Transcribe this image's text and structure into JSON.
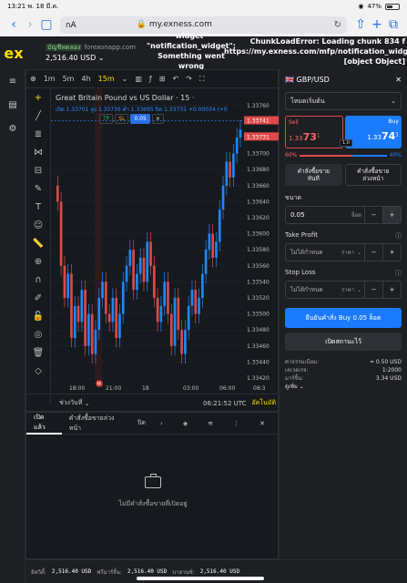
{
  "status": {
    "time": "13:21",
    "date": "พ. 18 มี.ค.",
    "battery": "47%"
  },
  "browser": {
    "aa": "กA",
    "domain": "my.exness.com"
  },
  "app": {
    "logo": "ex",
    "account_tag": "บัญชีทดลอง",
    "account_site": "forexonapp.com",
    "balance": "2,516.40 USD",
    "error1": "widget\"\n\"notification_widget\":\nSomething went\nwrong",
    "error2": "ChunkLoadError: Loading chunk 834 f\nhttps://my.exness.com/mfp/notification_widget\n[object Object]"
  },
  "chart": {
    "toolbar": [
      "1m",
      "5m",
      "4h",
      "15m"
    ],
    "active_tf": "15m",
    "title": "Great Britain Pound vs US Dollar · 15 ·",
    "ohlc": "เปิด 1.33701  สูง 1.33736  ต่ำ 1.33695  ปิด 1.33731  +0.00034 (+0",
    "tp": "TP",
    "sl": "SL",
    "lot": "0.05",
    "time_labels": [
      "18:00",
      "21:00",
      "18",
      "03:00",
      "06:00",
      "08:3"
    ],
    "price_labels": [
      "1.33760",
      "1.33740",
      "1.33720",
      "1.33700",
      "1.33680",
      "1.33660",
      "1.33640",
      "1.33620",
      "1.33600",
      "1.33580",
      "1.33560",
      "1.33540",
      "1.33520",
      "1.33500",
      "1.33480",
      "1.33460",
      "1.33440",
      "1.33420"
    ],
    "ask_label": "1.33741",
    "bid_label": "1.33731",
    "range_label": "ช่วงวันที่",
    "clock": "06:21:52 UTC",
    "auto": "อัตโนมัติ",
    "event_marker": "M"
  },
  "chart_data": {
    "type": "candlestick",
    "title": "Great Britain Pound vs US Dollar · 15 ·",
    "ylim": [
      1.3342,
      1.3377
    ],
    "closes": [
      1.3364,
      1.3356,
      1.3352,
      1.3355,
      1.3347,
      1.3351,
      1.3349,
      1.3353,
      1.3346,
      1.335,
      1.3345,
      1.3348,
      1.3352,
      1.3354,
      1.335,
      1.3349,
      1.3352,
      1.3347,
      1.335,
      1.3354,
      1.3356,
      1.3358,
      1.3353,
      1.3355,
      1.3357,
      1.3354,
      1.3359,
      1.3356,
      1.3352,
      1.3349,
      1.3351,
      1.3354,
      1.335,
      1.3346,
      1.3352,
      1.3348,
      1.3345,
      1.3348,
      1.3351,
      1.3353,
      1.335,
      1.3352,
      1.3355,
      1.3358,
      1.336,
      1.3357,
      1.3359,
      1.3363,
      1.3366,
      1.3369,
      1.3367,
      1.337,
      1.3372,
      1.3373
    ]
  },
  "order": {
    "symbol": "GBP/USD",
    "mode": "โหมดเริ่มต้น",
    "sell_label": "Sell",
    "sell_price_small": "1.33",
    "sell_price_big": "73",
    "sell_price_sup": "1",
    "buy_label": "Buy",
    "buy_price_small": "1.33",
    "buy_price_big": "74",
    "buy_price_sup": "1",
    "spread": "1.0",
    "sell_pct": "60%",
    "buy_pct": "40%",
    "tab_market": "คำสั่งซื้อขาย\nทันที",
    "tab_pending": "คำสั่งซื้อขาย\nล่วงหน้า",
    "volume_label": "ขนาด",
    "volume": "0.05",
    "volume_unit": "ล็อต",
    "tp_label": "Take Profit",
    "tp_placeholder": "ไม่ได้กำหนด",
    "tp_unit": "ราคา",
    "sl_label": "Stop Loss",
    "sl_placeholder": "ไม่ได้กำหนด",
    "sl_unit": "ราคา",
    "confirm": "ยืนยันคำสั่ง Buy 0.05 ล็อต",
    "advanced": "เปิดสถานะไว้",
    "fee_label": "ค่าธรรมเนียม:",
    "fee_value": "≈ 0.50 USD",
    "leverage_label": "เลเวอเรจ:",
    "leverage_value": "1:2000",
    "margin_label": "มาร์จิ้น:",
    "margin_value": "3.34 USD",
    "more": "ดูเพิ่ม"
  },
  "bottom": {
    "tabs": [
      "เปิดแล้ว",
      "คำสั่งซื้อขายล่วงหน้า",
      "ปิด"
    ],
    "empty": "ไม่มีคำสั่งซื้อขายที่เปิดอยู่"
  },
  "footer": {
    "equity_label": "อิควิตี้:",
    "equity": "2,516.40 USD",
    "free_margin_label": "ฟรีมาร์จิ้น:",
    "free_margin": "2,516.40 USD",
    "balance_label": "บาลานซ์:",
    "balance": "2,516.40 USD"
  },
  "colors": {
    "up": "#1e88ff",
    "down": "#e04848",
    "accent": "#ffde02"
  }
}
